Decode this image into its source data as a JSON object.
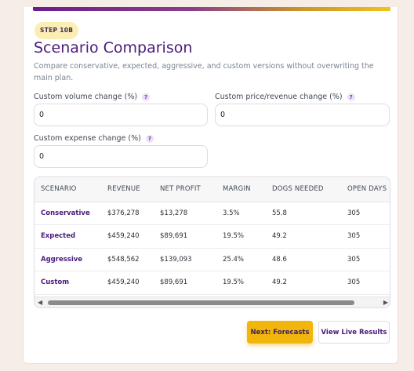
{
  "step_badge": "STEP 10B",
  "title": "Scenario Comparison",
  "subtitle": "Compare conservative, expected, aggressive, and custom versions without overwriting the main plan.",
  "help_glyph": "?",
  "fields": {
    "volume": {
      "label": "Custom volume change (%)",
      "value": "0"
    },
    "price": {
      "label": "Custom price/revenue change (%)",
      "value": "0"
    },
    "expense": {
      "label": "Custom expense change (%)",
      "value": "0"
    }
  },
  "table": {
    "headers": [
      "SCENARIO",
      "REVENUE",
      "NET PROFIT",
      "MARGIN",
      "DOGS NEEDED",
      "OPEN DAYS"
    ],
    "rows": [
      [
        "Conservative",
        "$376,278",
        "$13,278",
        "3.5%",
        "55.8",
        "305"
      ],
      [
        "Expected",
        "$459,240",
        "$89,691",
        "19.5%",
        "49.2",
        "305"
      ],
      [
        "Aggressive",
        "$548,562",
        "$139,093",
        "25.4%",
        "48.6",
        "305"
      ],
      [
        "Custom",
        "$459,240",
        "$89,691",
        "19.5%",
        "49.2",
        "305"
      ]
    ]
  },
  "scrollbar": {
    "left_arrow": "◀",
    "right_arrow": "▶"
  },
  "buttons": {
    "next": "Next: Forecasts",
    "live": "View Live Results"
  },
  "colors": {
    "accent_purple": "#4a1a7a",
    "accent_yellow": "#f2b50c",
    "badge_bg": "#fbeeb4"
  }
}
